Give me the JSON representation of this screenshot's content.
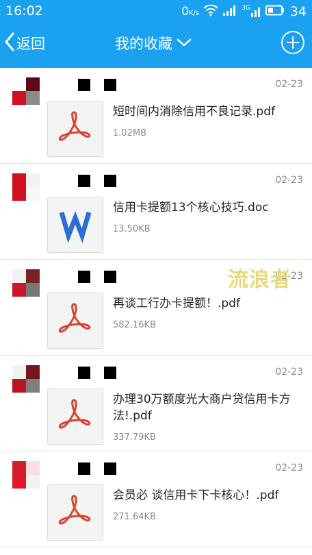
{
  "status_bar": {
    "time": "16:02",
    "speed_value": "0",
    "speed_unit": "K/s",
    "network": "3G",
    "battery": "34"
  },
  "nav": {
    "back_label": "返回",
    "title": "我的收藏"
  },
  "items": [
    {
      "date": "02-23",
      "file_name": "短时间内消除信用不良记录.pdf",
      "file_size": "1.02MB",
      "file_type": "pdf"
    },
    {
      "date": "02-23",
      "file_name": "信用卡提额13个核心技巧.doc",
      "file_size": "13.50KB",
      "file_type": "doc"
    },
    {
      "date": "02-23",
      "file_name": "再谈工行办卡提额！.pdf",
      "file_size": "582.16KB",
      "file_type": "pdf"
    },
    {
      "date": "02-23",
      "file_name": "办理30万额度光大商户贷信用卡方法!.pdf",
      "file_size": "337.79KB",
      "file_type": "pdf"
    },
    {
      "date": "02-23",
      "file_name": "会员必 谈信用卡下卡核心！.pdf",
      "file_size": "271.64KB",
      "file_type": "pdf"
    }
  ],
  "watermark": "流浪者",
  "colors": {
    "header_bg": "#1aa1f0",
    "pdf_red": "#d9452b",
    "word_blue": "#2b6fd4"
  }
}
